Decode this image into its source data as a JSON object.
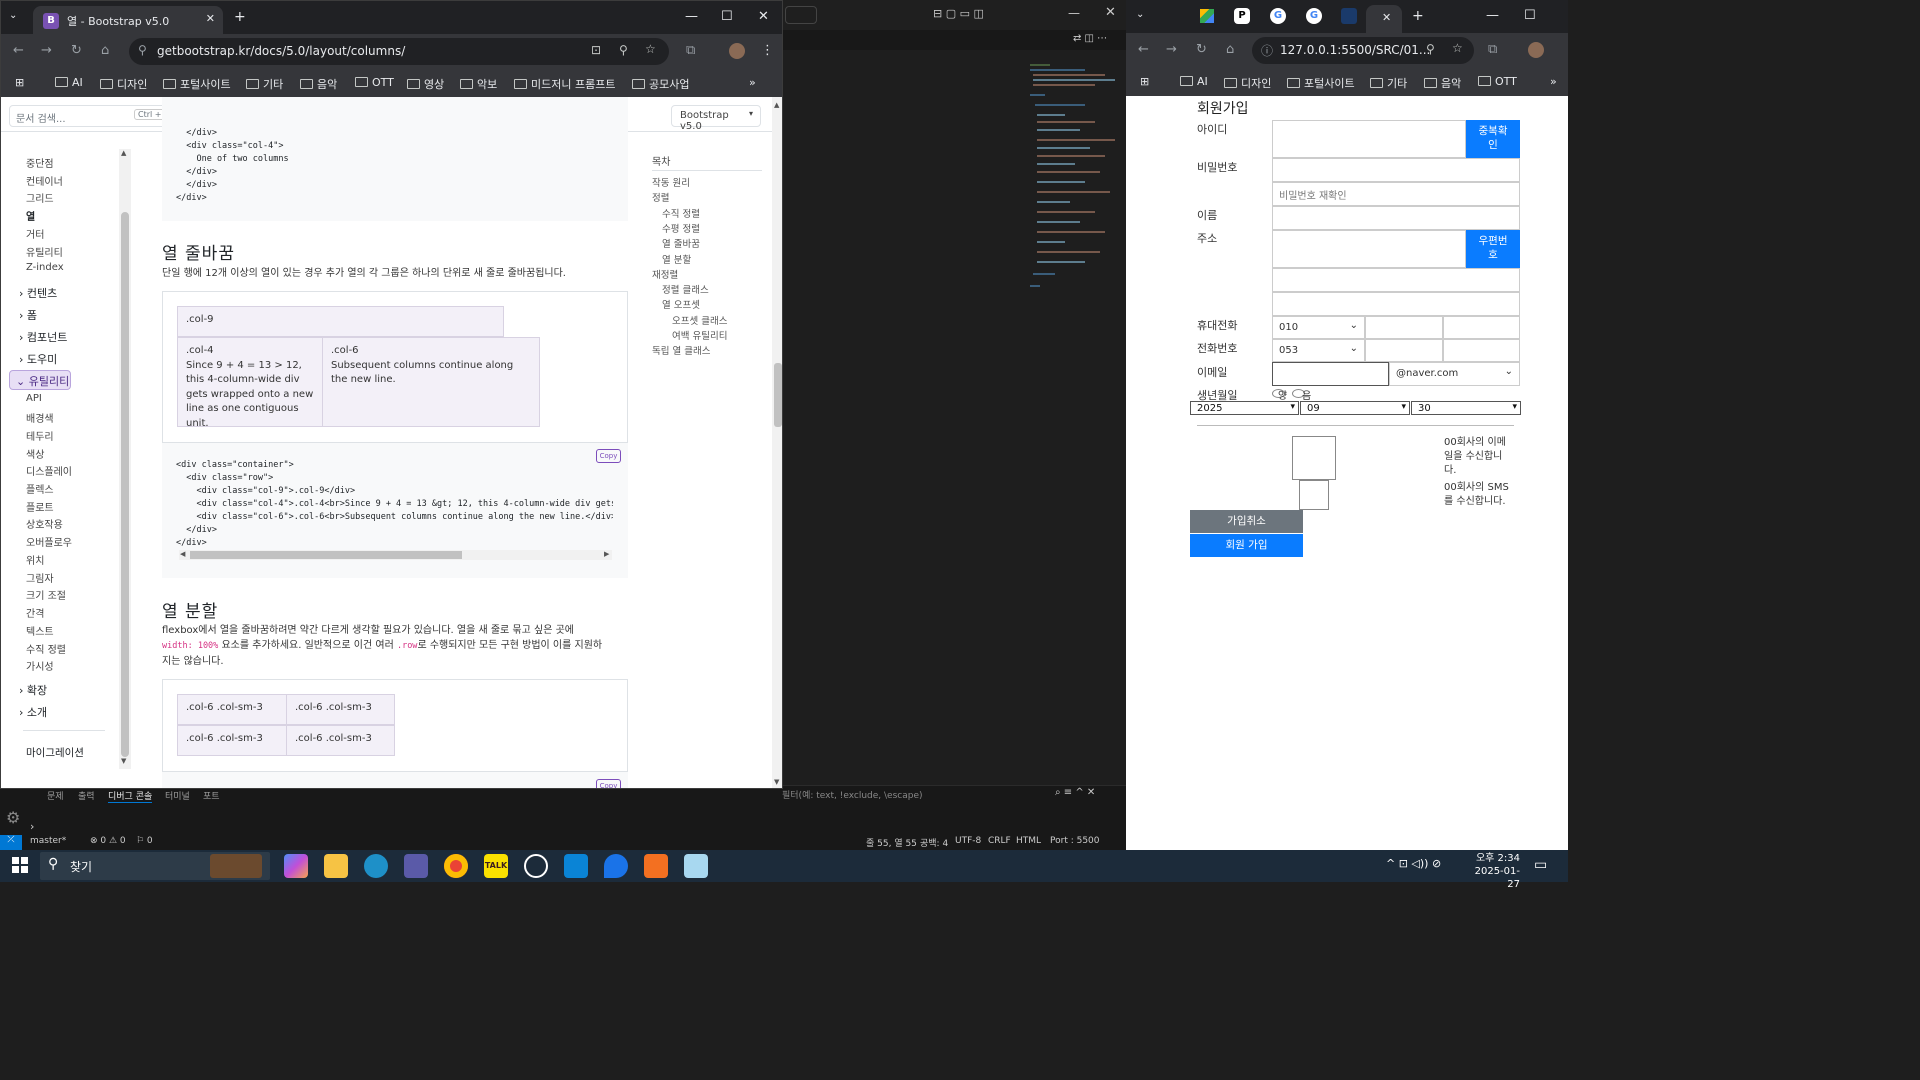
{
  "vscode": {
    "panel_tabs": [
      "문제",
      "출력",
      "디버그 콘솔",
      "터미널",
      "포트"
    ],
    "filter_placeholder": "필터(예: text, !exclude, \\escape)",
    "status": {
      "branch": "master*",
      "errors": "⊗ 0 ⚠ 0",
      "ports0": "⚐ 0",
      "position": "줄 55, 열 55",
      "spaces": "공백: 4",
      "encoding": "UTF-8",
      "eol": "CRLF",
      "language": "HTML",
      "port": "Port : 5500"
    }
  },
  "browser_a": {
    "tab_title": "열 - Bootstrap v5.0",
    "tab_favicon": "B",
    "url": "getbootstrap.kr/docs/5.0/layout/columns/",
    "bookmarks": [
      "AI",
      "디자인",
      "포털사이트",
      "기타",
      "음악",
      "OTT",
      "영상",
      "악보",
      "미드저니 프롬프트",
      "공모사업"
    ]
  },
  "docs": {
    "search_placeholder": "문서 검색...",
    "search_shortcut": "Ctrl + /",
    "version": "Bootstrap v5.0",
    "nav_top": [
      "중단점",
      "컨테이너",
      "그리드",
      "열",
      "거터",
      "유틸리티",
      "Z-index"
    ],
    "nav_groups": [
      "컨텐츠",
      "폼",
      "컴포넌트",
      "도우미"
    ],
    "nav_active": "유틸리티",
    "nav_utils": [
      "API",
      "배경색",
      "테두리",
      "색상",
      "디스플레이",
      "플렉스",
      "플로트",
      "상호작용",
      "오버플로우",
      "위치",
      "그림자",
      "크기 조절",
      "간격",
      "텍스트",
      "수직 정렬",
      "가시성"
    ],
    "nav_bottom": [
      "확장",
      "소개"
    ],
    "nav_migration": "마이그레이션",
    "code_top": [
      "  </div>",
      "  <div class=\"col-4\">",
      "    One of two columns",
      "  </div>",
      "  </div>",
      "</div>"
    ],
    "section1_title": "열 줄바꿈",
    "section1_desc": "단일 행에 12개 이상의 열이 있는 경우 추가 열의 각 그룹은 하나의 단위로 새 줄로 줄바꿈됩니다.",
    "demo_col9": ".col-9",
    "demo_col4": ".col-4\nSince 9 + 4 = 13 > 12, this 4-column-wide div gets wrapped onto a new line as one contiguous unit.",
    "demo_col6": ".col-6\nSubsequent columns continue along the new line.",
    "copy_label": "Copy",
    "code_mid": [
      "<div class=\"container\">",
      "  <div class=\"row\">",
      "    <div class=\"col-9\">.col-9</div>",
      "    <div class=\"col-4\">.col-4<br>Since 9 + 4 = 13 &gt; 12, this 4-column-wide div gets wrappe",
      "    <div class=\"col-6\">.col-6<br>Subsequent columns continue along the new line.</div>",
      "  </div>",
      "</div>"
    ],
    "section2_title": "열 분할",
    "section2_desc_1": "flexbox에서 열을 줄바꿈하려면 약간 다르게 생각할 필요가 있습니다. 열을 새 줄로 묶고 싶은 곳에",
    "section2_code": "width: 100%",
    "section2_desc_2": " 요소를 추가하세요. 일반적으로 이건 여러 ",
    "section2_row": ".row",
    "section2_desc_3": "로 수행되지만 모든 구현 방법이 이를 지원하",
    "section2_desc_4": "지는 않습니다.",
    "demo_split": [
      ".col-6 .col-sm-3",
      ".col-6 .col-sm-3",
      ".col-6 .col-sm-3",
      ".col-6 .col-sm-3"
    ],
    "toc_title": "목차",
    "toc": [
      [
        "작동 원리",
        0
      ],
      [
        "정렬",
        0
      ],
      [
        "수직 정렬",
        1
      ],
      [
        "수평 정렬",
        1
      ],
      [
        "열 줄바꿈",
        1
      ],
      [
        "열 분할",
        1
      ],
      [
        "재정렬",
        0
      ],
      [
        "정렬 클래스",
        1
      ],
      [
        "열 오프셋",
        1
      ],
      [
        "오프셋 클래스",
        2
      ],
      [
        "여백 유틸리티",
        2
      ],
      [
        "독립 열 클래스",
        0
      ]
    ]
  },
  "browser_b": {
    "url": "127.0.0.1:5500/SRC/01...",
    "bookmarks": [
      "AI",
      "디자인",
      "포털사이트",
      "기타",
      "음악",
      "OTT"
    ]
  },
  "signup": {
    "title": "회원가입",
    "label_id": "아이디",
    "btn_dup": "중복확\n인",
    "label_pw": "비밀번호",
    "pw_confirm_placeholder": "비밀번호 재확인",
    "label_name": "이름",
    "label_addr": "주소",
    "btn_zip": "우편번\n호",
    "label_mobile": "휴대전화",
    "mobile_prefix": "010",
    "label_phone": "전화번호",
    "phone_prefix": "053",
    "label_email": "이메일",
    "email_domain": "@naver.com",
    "label_birth": "생년월일",
    "calendar_solar": "양",
    "calendar_lunar": "음",
    "birth_year": "2025",
    "birth_month": "09",
    "birth_day": "30",
    "email_consent": "00회사의 이메\n일을 수신합니\n다.",
    "sms_consent": "00회사의 SMS\n를 수신합니다.",
    "btn_cancel": "가입취소",
    "btn_join": "회원 가입"
  },
  "taskbar": {
    "search": "찾기",
    "time": "오후 2:34",
    "date": "2025-01-27"
  }
}
